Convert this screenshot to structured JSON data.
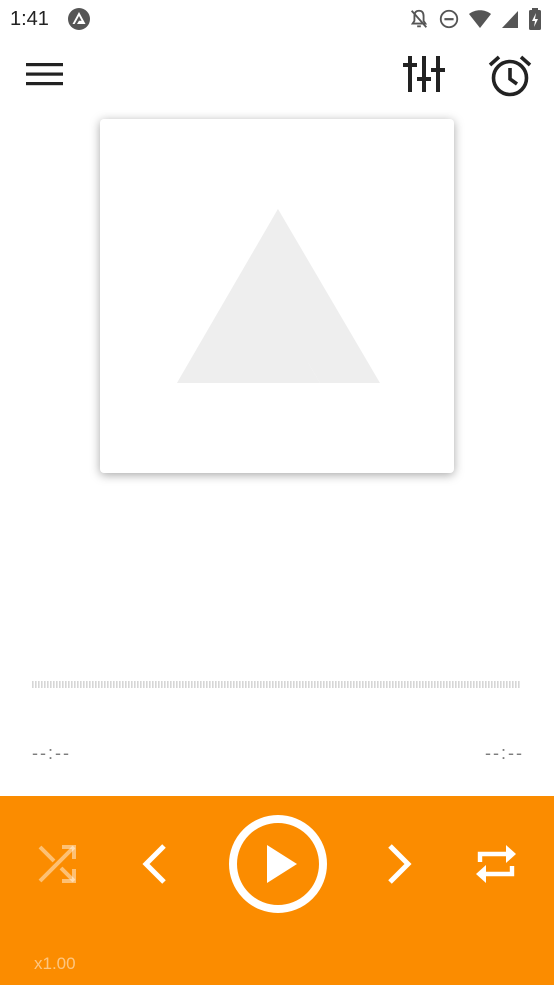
{
  "status_bar": {
    "time": "1:41",
    "left_icon": "app-logo-icon",
    "right_icons": [
      "bell-off-icon",
      "do-not-disturb-icon",
      "wifi-icon",
      "signal-icon",
      "battery-icon"
    ]
  },
  "toolbar": {
    "icons": [
      "menu-icon",
      "equalizer-icon",
      "alarm-clock-icon"
    ]
  },
  "player": {
    "album_art_icon": "app-logo-icon",
    "time_current": "--:--",
    "time_total": "--:--",
    "speed": "x1.00"
  },
  "controls": {
    "icons": [
      "shuffle-icon",
      "previous-icon",
      "play-icon",
      "next-icon",
      "repeat-icon"
    ]
  },
  "colors": {
    "accent": "#fb8c00",
    "status_icons": "#555555",
    "toolbar_icons": "#222222",
    "logo_placeholder": "#eeeeee",
    "waveform": "#d6d6d6",
    "time_text": "#7d7d7d",
    "control_icons": "#ffffff"
  }
}
